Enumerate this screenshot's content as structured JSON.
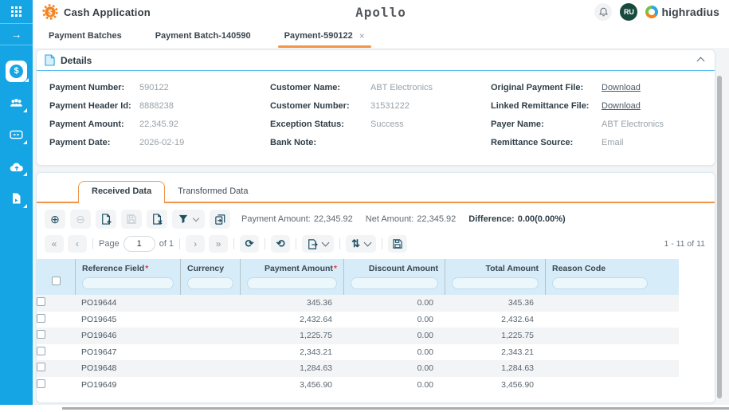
{
  "header": {
    "app_name": "Cash Application",
    "logo_text": "Apollo",
    "brand_name": "highradius",
    "avatar_initials": "RU"
  },
  "glyphs": {
    "dollar": "$",
    "arrow_right": "→",
    "close": "×",
    "add": "⊕",
    "remove": "⊖",
    "first_page": "«",
    "prev_page": "‹",
    "next_page": "›",
    "last_page": "»",
    "refresh": "⟳",
    "history": "⟲",
    "sort": "⇅"
  },
  "nav_tabs": {
    "tab1": "Payment Batches",
    "tab2": "Payment Batch-140590",
    "tab3": "Payment-590122"
  },
  "details": {
    "title": "Details",
    "fields": [
      {
        "label": "Payment Number:",
        "value": "590122"
      },
      {
        "label": "Payment Header Id:",
        "value": "8888238"
      },
      {
        "label": "Payment Amount:",
        "value": "22,345.92"
      },
      {
        "label": "Payment Date:",
        "value": "2026-02-19"
      },
      {
        "label": "Customer Name:",
        "value": "ABT Electronics"
      },
      {
        "label": "Customer Number:",
        "value": "31531222"
      },
      {
        "label": "Exception Status:",
        "value": "Success"
      },
      {
        "label": "Bank Note:",
        "value": ""
      },
      {
        "label": "Original Payment File:",
        "value": "Download"
      },
      {
        "label": "Linked Remittance File:",
        "value": "Download"
      },
      {
        "label": "Payer Name:",
        "value": "ABT Electronics"
      },
      {
        "label": "Remittance Source:",
        "value": "Email"
      }
    ]
  },
  "data_tabs": {
    "received": "Received Data",
    "transformed": "Transformed Data"
  },
  "summary": {
    "payment_amount_label": "Payment Amount:",
    "payment_amount": "22,345.92",
    "net_amount_label": "Net Amount:",
    "net_amount": "22,345.92",
    "difference_label": "Difference:",
    "difference": "0.00(0.00%)"
  },
  "pagination": {
    "page_label": "Page",
    "current_page": "1",
    "of_label": "of 1",
    "range_text": "1 - 11 of 11"
  },
  "table": {
    "required_marker": "*",
    "columns": [
      {
        "label": "Reference Field",
        "required": true
      },
      {
        "label": "Currency",
        "required": false
      },
      {
        "label": "Payment Amount",
        "required": true
      },
      {
        "label": "Discount Amount",
        "required": false
      },
      {
        "label": "Total Amount",
        "required": false
      },
      {
        "label": "Reason Code",
        "required": false
      }
    ],
    "rows": [
      {
        "reference": "PO19644",
        "currency": "",
        "payment_amount": "345.36",
        "discount_amount": "0.00",
        "total_amount": "345.36",
        "reason_code": ""
      },
      {
        "reference": "PO19645",
        "currency": "",
        "payment_amount": "2,432.64",
        "discount_amount": "0.00",
        "total_amount": "2,432.64",
        "reason_code": ""
      },
      {
        "reference": "PO19646",
        "currency": "",
        "payment_amount": "1,225.75",
        "discount_amount": "0.00",
        "total_amount": "1,225.75",
        "reason_code": ""
      },
      {
        "reference": "PO19647",
        "currency": "",
        "payment_amount": "2,343.21",
        "discount_amount": "0.00",
        "total_amount": "2,343.21",
        "reason_code": ""
      },
      {
        "reference": "PO19648",
        "currency": "",
        "payment_amount": "1,284.63",
        "discount_amount": "0.00",
        "total_amount": "1,284.63",
        "reason_code": ""
      },
      {
        "reference": "PO19649",
        "currency": "",
        "payment_amount": "3,456.90",
        "discount_amount": "0.00",
        "total_amount": "3,456.90",
        "reason_code": ""
      }
    ]
  }
}
